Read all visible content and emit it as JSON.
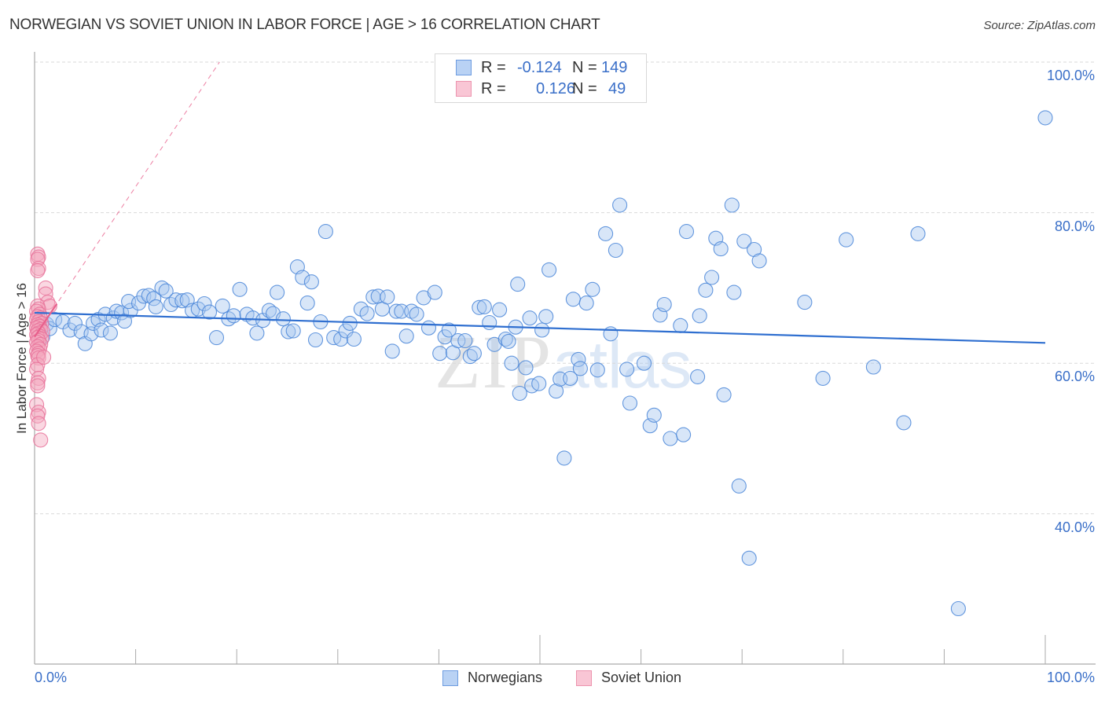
{
  "header": {
    "title": "NORWEGIAN VS SOVIET UNION IN LABOR FORCE | AGE > 16 CORRELATION CHART",
    "source": "Source: ZipAtlas.com"
  },
  "legend_top": {
    "rows": [
      {
        "swatch": "norwegians",
        "r_label": "R =",
        "r_value": "-0.124",
        "n_label": "N =",
        "n_value": "149"
      },
      {
        "swatch": "soviet",
        "r_label": "R =",
        "r_value": "0.126",
        "n_label": "N =",
        "n_value": "49"
      }
    ]
  },
  "legend_bottom": [
    {
      "key": "norwegians",
      "label": "Norwegians"
    },
    {
      "key": "soviet",
      "label": "Soviet Union"
    }
  ],
  "watermark": {
    "part1": "ZIP",
    "part2": "atlas"
  },
  "colors": {
    "norwegians_fill": "#a9c8f0",
    "norwegians_stroke": "#4a86d8",
    "norwegians_line": "#2f6fd0",
    "soviet_fill": "#f5a9bf",
    "soviet_stroke": "#e8729a",
    "soviet_line": "#e8608c",
    "tick_text": "#3a6fc8",
    "grid": "#d9d9d9"
  },
  "chart_data": {
    "type": "scatter",
    "title": "NORWEGIAN VS SOVIET UNION IN LABOR FORCE | AGE > 16 CORRELATION CHART",
    "xlabel": "",
    "ylabel": "In Labor Force | Age > 16",
    "xlim": [
      0,
      100
    ],
    "ylim": [
      20,
      100
    ],
    "x_tick_labels": [
      {
        "value": 0,
        "label": "0.0%"
      },
      {
        "value": 100,
        "label": "100.0%"
      }
    ],
    "y_tick_labels": [
      {
        "value": 100,
        "label": "100.0%"
      },
      {
        "value": 80,
        "label": "80.0%"
      },
      {
        "value": 60,
        "label": "60.0%"
      },
      {
        "value": 40,
        "label": "40.0%"
      }
    ],
    "x_minor_ticks": [
      10,
      20,
      30,
      40,
      60,
      70,
      80,
      90
    ],
    "x_major_ticks": [
      50,
      100
    ],
    "grid": true,
    "legend_placement": "top-center and bottom-center",
    "series": [
      {
        "name": "Norwegians",
        "r": -0.124,
        "n": 149,
        "trend": {
          "x0": 0,
          "y0": 66.7,
          "x1": 100,
          "y1": 62.7
        },
        "points": [
          [
            0.8,
            63.5
          ],
          [
            1.2,
            65.2
          ],
          [
            1.5,
            64.6
          ],
          [
            2.0,
            65.8
          ],
          [
            2.8,
            65.5
          ],
          [
            3.5,
            64.4
          ],
          [
            4.0,
            65.3
          ],
          [
            4.6,
            64.2
          ],
          [
            5.0,
            62.6
          ],
          [
            5.6,
            63.9
          ],
          [
            5.8,
            65.3
          ],
          [
            6.3,
            65.8
          ],
          [
            6.6,
            64.4
          ],
          [
            7.0,
            66.5
          ],
          [
            7.5,
            64.0
          ],
          [
            7.8,
            66.0
          ],
          [
            8.1,
            66.9
          ],
          [
            8.6,
            66.7
          ],
          [
            8.9,
            65.6
          ],
          [
            9.5,
            67.0
          ],
          [
            9.3,
            68.2
          ],
          [
            10.3,
            68.0
          ],
          [
            10.8,
            68.9
          ],
          [
            11.3,
            69.0
          ],
          [
            11.8,
            68.6
          ],
          [
            12.0,
            67.5
          ],
          [
            12.6,
            70.0
          ],
          [
            13.0,
            69.6
          ],
          [
            13.5,
            67.8
          ],
          [
            14.0,
            68.4
          ],
          [
            14.6,
            68.3
          ],
          [
            15.1,
            68.4
          ],
          [
            15.6,
            67.0
          ],
          [
            16.2,
            67.2
          ],
          [
            16.8,
            67.9
          ],
          [
            17.3,
            66.8
          ],
          [
            18.0,
            63.4
          ],
          [
            18.6,
            67.6
          ],
          [
            19.2,
            65.9
          ],
          [
            19.7,
            66.3
          ],
          [
            20.3,
            69.8
          ],
          [
            21.0,
            66.5
          ],
          [
            21.6,
            66.0
          ],
          [
            22.0,
            64.0
          ],
          [
            22.6,
            65.7
          ],
          [
            23.2,
            67.0
          ],
          [
            23.6,
            66.6
          ],
          [
            24.0,
            69.4
          ],
          [
            24.6,
            65.9
          ],
          [
            25.1,
            64.2
          ],
          [
            25.6,
            64.3
          ],
          [
            26.0,
            72.8
          ],
          [
            26.5,
            71.4
          ],
          [
            27.0,
            68.0
          ],
          [
            27.4,
            70.8
          ],
          [
            27.8,
            63.1
          ],
          [
            28.3,
            65.5
          ],
          [
            28.8,
            77.5
          ],
          [
            29.6,
            63.4
          ],
          [
            30.3,
            63.2
          ],
          [
            30.8,
            64.3
          ],
          [
            31.2,
            65.3
          ],
          [
            31.6,
            63.2
          ],
          [
            32.3,
            67.2
          ],
          [
            32.9,
            66.6
          ],
          [
            33.5,
            68.8
          ],
          [
            34.0,
            68.9
          ],
          [
            34.4,
            67.2
          ],
          [
            34.9,
            68.8
          ],
          [
            35.4,
            61.6
          ],
          [
            35.8,
            66.9
          ],
          [
            36.3,
            66.9
          ],
          [
            36.8,
            63.6
          ],
          [
            37.3,
            66.9
          ],
          [
            37.8,
            66.5
          ],
          [
            38.5,
            68.7
          ],
          [
            39.0,
            64.7
          ],
          [
            39.6,
            69.4
          ],
          [
            40.1,
            61.3
          ],
          [
            40.6,
            63.5
          ],
          [
            41.0,
            64.4
          ],
          [
            41.4,
            61.4
          ],
          [
            41.9,
            63.0
          ],
          [
            42.6,
            63.0
          ],
          [
            43.1,
            60.9
          ],
          [
            43.5,
            61.3
          ],
          [
            44.0,
            67.4
          ],
          [
            44.5,
            67.5
          ],
          [
            45.0,
            65.4
          ],
          [
            45.5,
            62.5
          ],
          [
            46.0,
            67.1
          ],
          [
            46.6,
            63.2
          ],
          [
            46.9,
            62.9
          ],
          [
            47.2,
            60.0
          ],
          [
            47.6,
            64.8
          ],
          [
            47.8,
            70.5
          ],
          [
            48.0,
            56.0
          ],
          [
            48.6,
            59.4
          ],
          [
            49.0,
            66.0
          ],
          [
            49.2,
            57.0
          ],
          [
            49.9,
            57.3
          ],
          [
            50.2,
            64.4
          ],
          [
            50.6,
            66.2
          ],
          [
            50.9,
            72.4
          ],
          [
            51.6,
            56.3
          ],
          [
            52.0,
            57.9
          ],
          [
            52.4,
            47.4
          ],
          [
            53.0,
            58.0
          ],
          [
            53.3,
            68.5
          ],
          [
            53.8,
            60.5
          ],
          [
            54.0,
            59.3
          ],
          [
            54.6,
            68.0
          ],
          [
            55.2,
            69.8
          ],
          [
            55.7,
            59.1
          ],
          [
            56.5,
            77.2
          ],
          [
            57.0,
            63.9
          ],
          [
            57.5,
            75.0
          ],
          [
            57.9,
            81.0
          ],
          [
            58.6,
            59.2
          ],
          [
            58.9,
            54.7
          ],
          [
            60.3,
            60.0
          ],
          [
            60.9,
            51.7
          ],
          [
            61.3,
            53.1
          ],
          [
            61.9,
            66.4
          ],
          [
            62.3,
            67.8
          ],
          [
            62.9,
            50.0
          ],
          [
            63.9,
            65.0
          ],
          [
            64.2,
            50.5
          ],
          [
            64.5,
            77.5
          ],
          [
            65.6,
            58.2
          ],
          [
            65.8,
            66.3
          ],
          [
            66.4,
            69.7
          ],
          [
            67.0,
            71.4
          ],
          [
            67.4,
            76.6
          ],
          [
            67.9,
            75.2
          ],
          [
            68.2,
            55.8
          ],
          [
            69.0,
            81.0
          ],
          [
            69.2,
            69.4
          ],
          [
            69.7,
            43.7
          ],
          [
            70.2,
            76.2
          ],
          [
            70.7,
            34.1
          ],
          [
            71.2,
            75.1
          ],
          [
            71.7,
            73.6
          ],
          [
            76.2,
            68.1
          ],
          [
            78.0,
            58.0
          ],
          [
            80.3,
            76.4
          ],
          [
            83.0,
            59.5
          ],
          [
            86.0,
            52.1
          ],
          [
            87.4,
            77.2
          ],
          [
            91.4,
            27.4
          ],
          [
            100.0,
            92.6
          ]
        ]
      },
      {
        "name": "Soviet Union",
        "r": 0.126,
        "n": 49,
        "trend": {
          "x0": 0,
          "y0": 63.5,
          "x1": 18.3,
          "y1": 100
        },
        "points": [
          [
            0.3,
            74.5
          ],
          [
            0.4,
            74.1
          ],
          [
            0.3,
            73.8
          ],
          [
            0.4,
            72.6
          ],
          [
            0.3,
            72.3
          ],
          [
            1.1,
            70.0
          ],
          [
            1.1,
            69.2
          ],
          [
            1.3,
            68.1
          ],
          [
            1.5,
            67.6
          ],
          [
            0.3,
            67.6
          ],
          [
            0.4,
            67.2
          ],
          [
            0.2,
            66.9
          ],
          [
            0.5,
            66.5
          ],
          [
            0.3,
            66.2
          ],
          [
            0.6,
            66.0
          ],
          [
            0.2,
            65.8
          ],
          [
            0.4,
            65.5
          ],
          [
            0.7,
            65.3
          ],
          [
            0.3,
            65.1
          ],
          [
            0.5,
            64.9
          ],
          [
            0.2,
            64.7
          ],
          [
            0.6,
            64.5
          ],
          [
            0.3,
            64.3
          ],
          [
            0.8,
            64.2
          ],
          [
            0.4,
            64.0
          ],
          [
            0.2,
            63.8
          ],
          [
            0.5,
            63.6
          ],
          [
            0.3,
            63.4
          ],
          [
            0.7,
            63.2
          ],
          [
            0.4,
            63.0
          ],
          [
            0.2,
            62.8
          ],
          [
            0.6,
            62.5
          ],
          [
            0.3,
            62.2
          ],
          [
            0.5,
            61.9
          ],
          [
            0.2,
            61.6
          ],
          [
            0.4,
            61.3
          ],
          [
            0.3,
            61.0
          ],
          [
            0.4,
            60.7
          ],
          [
            0.3,
            59.8
          ],
          [
            0.2,
            59.2
          ],
          [
            0.4,
            58.0
          ],
          [
            0.3,
            57.4
          ],
          [
            0.3,
            57.0
          ],
          [
            0.2,
            54.5
          ],
          [
            0.4,
            53.5
          ],
          [
            0.3,
            53.0
          ],
          [
            0.4,
            52.0
          ],
          [
            0.6,
            49.8
          ],
          [
            0.9,
            60.8
          ]
        ]
      }
    ]
  }
}
